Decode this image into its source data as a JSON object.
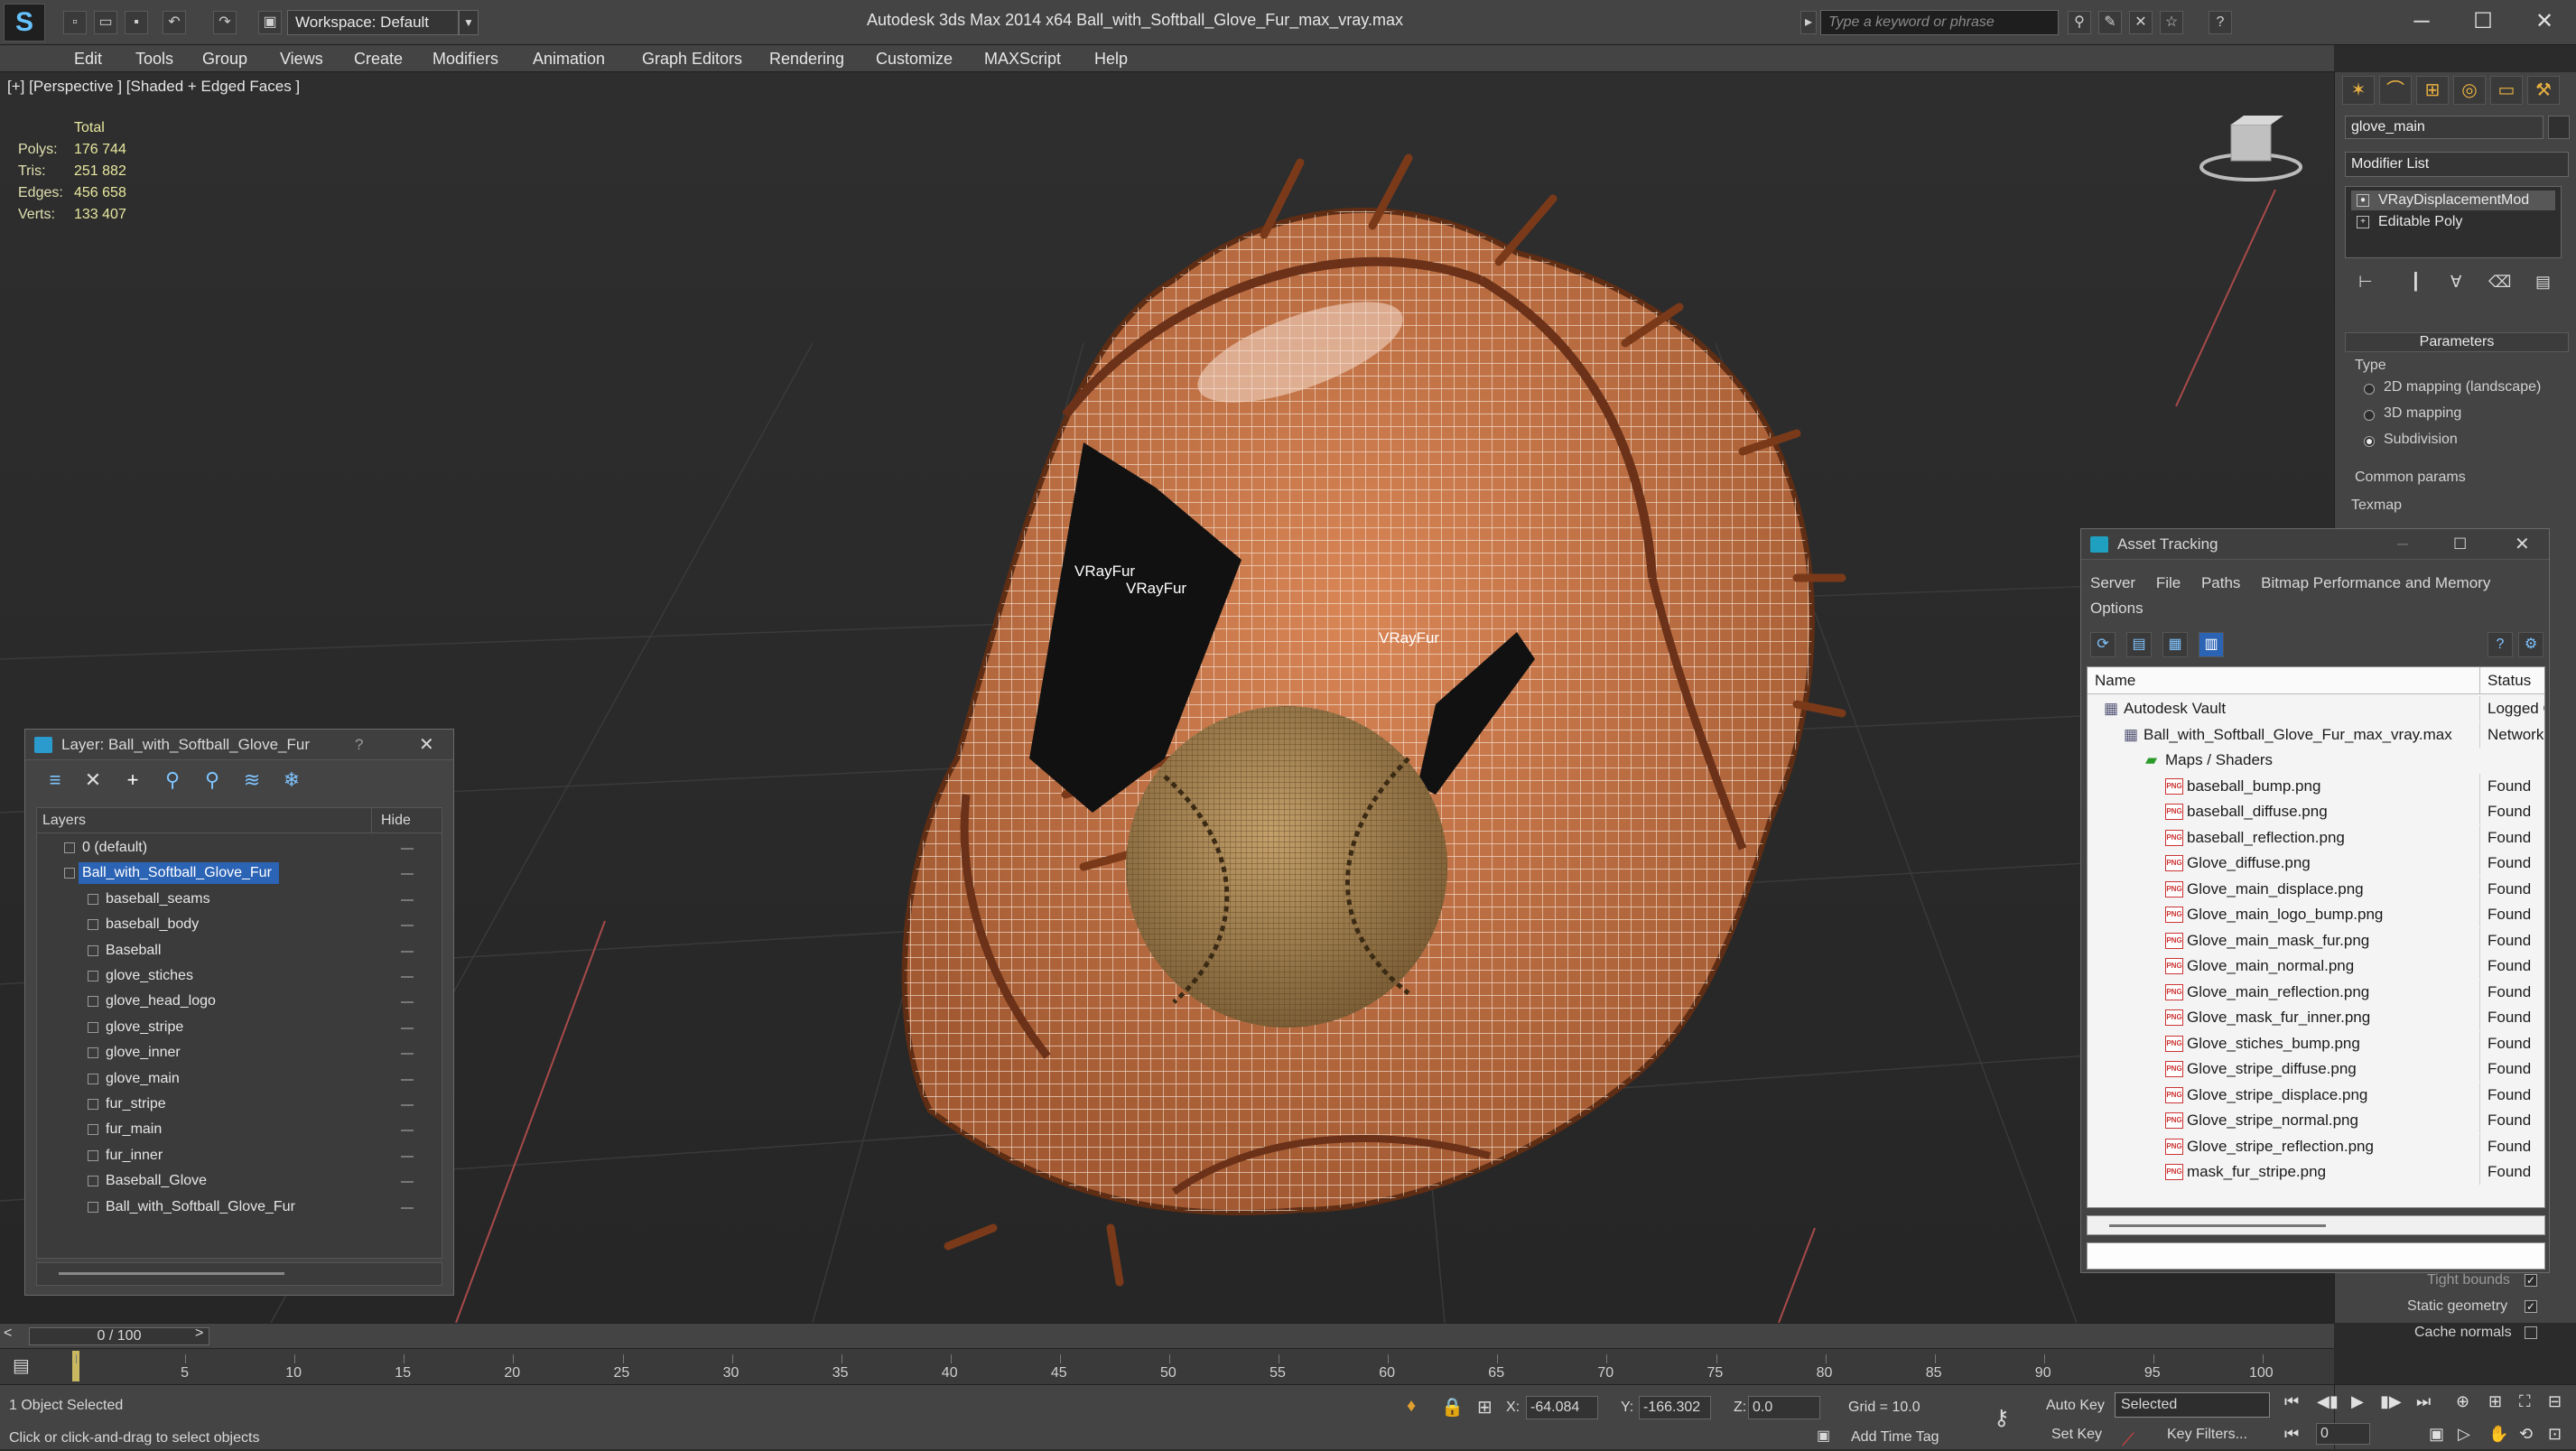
{
  "titlebar": {
    "workspace": "Workspace: Default",
    "app_title": "Autodesk 3ds Max  2014 x64      Ball_with_Softball_Glove_Fur_max_vray.max",
    "search_placeholder": "Type a keyword or phrase"
  },
  "menu": [
    "Edit",
    "Tools",
    "Group",
    "Views",
    "Create",
    "Modifiers",
    "Animation",
    "Graph Editors",
    "Rendering",
    "Customize",
    "MAXScript",
    "Help"
  ],
  "viewport": {
    "label": "[+] [Perspective ] [Shaded + Edged Faces ]",
    "stats": {
      "total_label": "Total",
      "rows": [
        {
          "label": "Polys:",
          "value": "176 744"
        },
        {
          "label": "Tris:",
          "value": "251 882"
        },
        {
          "label": "Edges:",
          "value": "456 658"
        },
        {
          "label": "Verts:",
          "value": "133 407"
        }
      ]
    },
    "vrayfur_labels": [
      "VRayFur",
      "VRayFur",
      "VRayFur"
    ]
  },
  "command_panel": {
    "object_name": "glove_main",
    "modifier_list": "Modifier List",
    "stack": [
      "VRayDisplacementMod",
      "Editable Poly"
    ],
    "parameters_title": "Parameters",
    "type_label": "Type",
    "type_options": [
      {
        "label": "2D mapping (landscape)",
        "selected": false
      },
      {
        "label": "3D mapping",
        "selected": false
      },
      {
        "label": "Subdivision",
        "selected": true
      }
    ],
    "common_params": "Common params",
    "texmap": "Texmap",
    "tight_bounds": "Tight bounds",
    "static_geometry": "Static geometry",
    "cache_normals": "Cache normals"
  },
  "layer_window": {
    "title": "Layer: Ball_with_Softball_Glove_Fur",
    "help": "?",
    "col_layers": "Layers",
    "col_hide": "Hide",
    "rows": [
      {
        "name": "0 (default)",
        "level": 0,
        "selected": false
      },
      {
        "name": "Ball_with_Softball_Glove_Fur",
        "level": 0,
        "selected": true
      },
      {
        "name": "baseball_seams",
        "level": 1,
        "selected": false
      },
      {
        "name": "baseball_body",
        "level": 1,
        "selected": false
      },
      {
        "name": "Baseball",
        "level": 1,
        "selected": false
      },
      {
        "name": "glove_stiches",
        "level": 1,
        "selected": false
      },
      {
        "name": "glove_head_logo",
        "level": 1,
        "selected": false
      },
      {
        "name": "glove_stripe",
        "level": 1,
        "selected": false
      },
      {
        "name": "glove_inner",
        "level": 1,
        "selected": false
      },
      {
        "name": "glove_main",
        "level": 1,
        "selected": false
      },
      {
        "name": "fur_stripe",
        "level": 1,
        "selected": false
      },
      {
        "name": "fur_main",
        "level": 1,
        "selected": false
      },
      {
        "name": "fur_inner",
        "level": 1,
        "selected": false
      },
      {
        "name": "Baseball_Glove",
        "level": 1,
        "selected": false
      },
      {
        "name": "Ball_with_Softball_Glove_Fur",
        "level": 1,
        "selected": false
      }
    ]
  },
  "asset_window": {
    "title": "Asset Tracking",
    "menu": [
      "Server",
      "File",
      "Paths",
      "Bitmap Performance and Memory"
    ],
    "menu_row2": [
      "Options"
    ],
    "col_name": "Name",
    "col_status": "Status",
    "rows": [
      {
        "name": "Autodesk Vault",
        "status": "Logged O",
        "level": 0
      },
      {
        "name": "Ball_with_Softball_Glove_Fur_max_vray.max",
        "status": "Network",
        "level": 1
      },
      {
        "name": "Maps / Shaders",
        "status": "",
        "level": 2
      },
      {
        "name": "baseball_bump.png",
        "status": "Found",
        "level": 3
      },
      {
        "name": "baseball_diffuse.png",
        "status": "Found",
        "level": 3
      },
      {
        "name": "baseball_reflection.png",
        "status": "Found",
        "level": 3
      },
      {
        "name": "Glove_diffuse.png",
        "status": "Found",
        "level": 3
      },
      {
        "name": "Glove_main_displace.png",
        "status": "Found",
        "level": 3
      },
      {
        "name": "Glove_main_logo_bump.png",
        "status": "Found",
        "level": 3
      },
      {
        "name": "Glove_main_mask_fur.png",
        "status": "Found",
        "level": 3
      },
      {
        "name": "Glove_main_normal.png",
        "status": "Found",
        "level": 3
      },
      {
        "name": "Glove_main_reflection.png",
        "status": "Found",
        "level": 3
      },
      {
        "name": "Glove_mask_fur_inner.png",
        "status": "Found",
        "level": 3
      },
      {
        "name": "Glove_stiches_bump.png",
        "status": "Found",
        "level": 3
      },
      {
        "name": "Glove_stripe_diffuse.png",
        "status": "Found",
        "level": 3
      },
      {
        "name": "Glove_stripe_displace.png",
        "status": "Found",
        "level": 3
      },
      {
        "name": "Glove_stripe_normal.png",
        "status": "Found",
        "level": 3
      },
      {
        "name": "Glove_stripe_reflection.png",
        "status": "Found",
        "level": 3
      },
      {
        "name": "mask_fur_stripe.png",
        "status": "Found",
        "level": 3
      }
    ]
  },
  "timeline": {
    "slider": "0 / 100",
    "ticks": [
      "0",
      "5",
      "10",
      "15",
      "20",
      "25",
      "30",
      "35",
      "40",
      "45",
      "50",
      "55",
      "60",
      "65",
      "70",
      "75",
      "80",
      "85",
      "90",
      "95",
      "100"
    ]
  },
  "status": {
    "selection": "1 Object Selected",
    "prompt": "Click or click-and-drag to select objects",
    "x_label": "X:",
    "x": "-64.084",
    "y_label": "Y:",
    "y": "-166.302",
    "z_label": "Z:",
    "z": "0.0",
    "grid": "Grid = 10.0",
    "add_time_tag": "Add Time Tag",
    "auto_key": "Auto Key",
    "set_key": "Set Key",
    "selected": "Selected",
    "key_filters": "Key Filters...",
    "frame": "0"
  },
  "colors": {
    "glove_leather": "#c8734a",
    "wire": "#f5e6d8",
    "ball": "#a58350",
    "selection": "#2b63b5"
  }
}
